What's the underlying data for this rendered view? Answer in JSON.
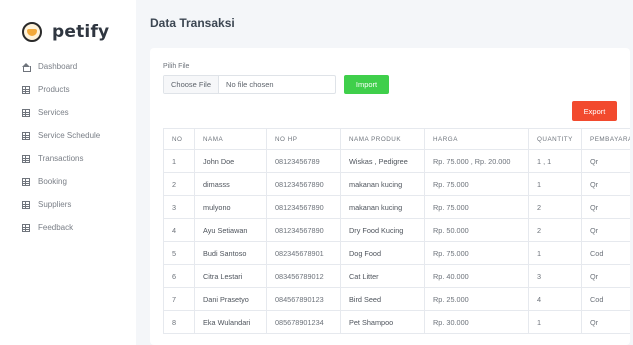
{
  "brand": {
    "name": "petify"
  },
  "sidebar": {
    "items": [
      {
        "label": "Dashboard",
        "icon": "home-icon"
      },
      {
        "label": "Products",
        "icon": "table-icon"
      },
      {
        "label": "Services",
        "icon": "table-icon"
      },
      {
        "label": "Service Schedule",
        "icon": "table-icon"
      },
      {
        "label": "Transactions",
        "icon": "table-icon"
      },
      {
        "label": "Booking",
        "icon": "table-icon"
      },
      {
        "label": "Suppliers",
        "icon": "table-icon"
      },
      {
        "label": "Feedback",
        "icon": "table-icon"
      }
    ]
  },
  "page": {
    "title": "Data Transaksi"
  },
  "upload": {
    "label": "Pilih File",
    "choose_label": "Choose File",
    "status": "No file chosen",
    "import_label": "Import"
  },
  "export_label": "Export",
  "colors": {
    "import": "#3fcf4b",
    "export": "#f24a2e"
  },
  "table": {
    "headers": [
      "NO",
      "NAMA",
      "NO HP",
      "NAMA PRODUK",
      "HARGA",
      "QUANTITY",
      "PEMBAYARAN"
    ],
    "rows": [
      [
        "1",
        "John Doe",
        "08123456789",
        "Wiskas , Pedigree",
        "Rp. 75.000 , Rp. 20.000",
        "1 , 1",
        "Qr"
      ],
      [
        "2",
        "dimasss",
        "081234567890",
        "makanan kucing",
        "Rp. 75.000",
        "1",
        "Qr"
      ],
      [
        "3",
        "mulyono",
        "081234567890",
        "makanan kucing",
        "Rp. 75.000",
        "2",
        "Qr"
      ],
      [
        "4",
        "Ayu Setiawan",
        "081234567890",
        "Dry Food Kucing",
        "Rp. 50.000",
        "2",
        "Qr"
      ],
      [
        "5",
        "Budi Santoso",
        "082345678901",
        "Dog Food",
        "Rp. 75.000",
        "1",
        "Cod"
      ],
      [
        "6",
        "Citra Lestari",
        "083456789012",
        "Cat Litter",
        "Rp. 40.000",
        "3",
        "Qr"
      ],
      [
        "7",
        "Dani Prasetyo",
        "084567890123",
        "Bird Seed",
        "Rp. 25.000",
        "4",
        "Cod"
      ],
      [
        "8",
        "Eka Wulandari",
        "085678901234",
        "Pet Shampoo",
        "Rp. 30.000",
        "1",
        "Qr"
      ]
    ]
  }
}
